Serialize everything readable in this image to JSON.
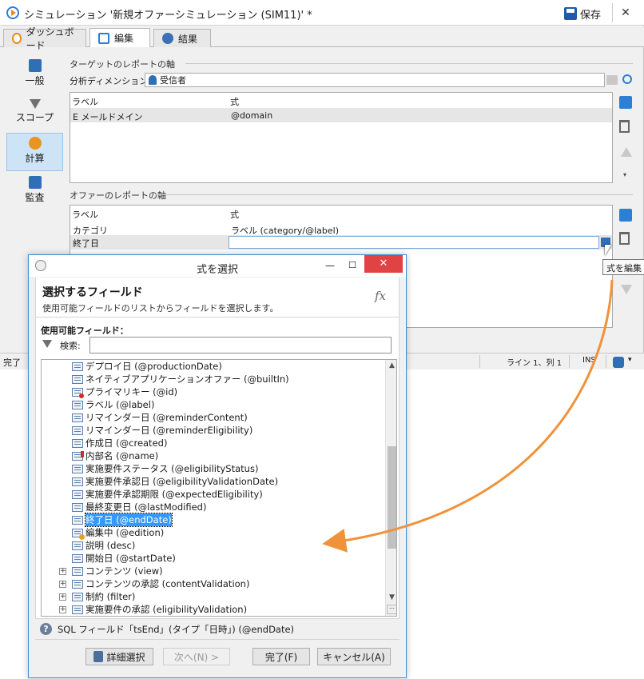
{
  "window": {
    "title": "シミュレーション '新規オファーシミュレーション (SIM11)' *",
    "save_label": "保存",
    "close_glyph": "✕"
  },
  "tabs": [
    {
      "label": "ダッシュボード"
    },
    {
      "label": "編集"
    },
    {
      "label": "結果"
    }
  ],
  "nav": [
    {
      "label": "一般"
    },
    {
      "label": "スコープ"
    },
    {
      "label": "計算"
    },
    {
      "label": "監査"
    }
  ],
  "target_section": {
    "title": "ターゲットのレポートの軸",
    "dimension_label": "分析ディメンション:",
    "dimension_value": "受信者",
    "columns": [
      "ラベル",
      "式"
    ],
    "rows": [
      {
        "label": "E メールドメイン",
        "expr": "@domain"
      }
    ]
  },
  "offer_section": {
    "title": "オファーのレポートの軸",
    "columns": [
      "ラベル",
      "式"
    ],
    "rows": [
      {
        "label": "カテゴリ",
        "expr": "ラベル (category/@label)"
      },
      {
        "label": "終了日",
        "expr": ""
      }
    ]
  },
  "tooltip": "式を編集",
  "statusbar": {
    "left": "完了",
    "position": "ライン 1、列 1",
    "mode": "INS"
  },
  "dialog": {
    "title": "式を選択",
    "header_title": "選択するフィールド",
    "header_desc": "使用可能フィールドのリストからフィールドを選択します。",
    "fx": "fx",
    "fields_label": "使用可能フィールド：",
    "search_label": "検索:",
    "search_value": "",
    "tree": [
      {
        "text": "デプロイ日 (@productionDate)",
        "kind": "field"
      },
      {
        "text": "ネイティブアプリケーションオファー (@builtIn)",
        "kind": "field"
      },
      {
        "text": "プライマリキー (@id)",
        "kind": "key"
      },
      {
        "text": "ラベル (@label)",
        "kind": "field"
      },
      {
        "text": "リマインダー日 (@reminderContent)",
        "kind": "field"
      },
      {
        "text": "リマインダー日 (@reminderEligibility)",
        "kind": "field"
      },
      {
        "text": "作成日 (@created)",
        "kind": "field"
      },
      {
        "text": "内部名 (@name)",
        "kind": "required"
      },
      {
        "text": "実施要件ステータス (@eligibilityStatus)",
        "kind": "field"
      },
      {
        "text": "実施要件承認日 (@eligibilityValidationDate)",
        "kind": "field"
      },
      {
        "text": "実施要件承認期限 (@expectedEligibility)",
        "kind": "field"
      },
      {
        "text": "最終変更日 (@lastModified)",
        "kind": "field"
      },
      {
        "text": "終了日 (@endDate)",
        "kind": "selected"
      },
      {
        "text": "編集中 (@edition)",
        "kind": "computed"
      },
      {
        "text": "説明 (desc)",
        "kind": "field"
      },
      {
        "text": "開始日 (@startDate)",
        "kind": "field"
      },
      {
        "text": "コンテンツ (view)",
        "kind": "node"
      },
      {
        "text": "コンテンツの承認 (contentValidation)",
        "kind": "node"
      },
      {
        "text": "制約 (filter)",
        "kind": "node"
      },
      {
        "text": "実施要件の承認 (eligibilityValidation)",
        "kind": "node"
      }
    ],
    "info": "SQL フィールド「tsEnd」(タイプ「日時」) (@endDate)",
    "buttons": {
      "advanced": "詳細選択",
      "next": "次へ(N) >",
      "finish": "完了(F)",
      "cancel": "キャンセル(A)"
    }
  },
  "colors": {
    "accent": "#3399ff",
    "close_red": "#e04343",
    "arrow": "#f0923a"
  }
}
